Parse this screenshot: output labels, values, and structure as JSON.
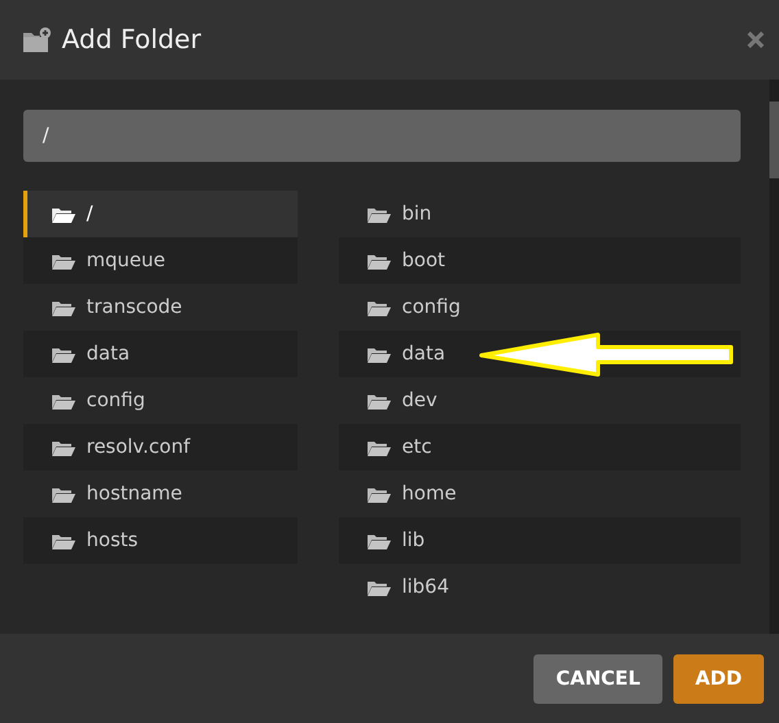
{
  "dialog": {
    "title": "Add Folder"
  },
  "path_field": {
    "value": "/"
  },
  "left_list": [
    {
      "label": "/",
      "selected": true
    },
    {
      "label": "mqueue",
      "selected": false
    },
    {
      "label": "transcode",
      "selected": false
    },
    {
      "label": "data",
      "selected": false
    },
    {
      "label": "config",
      "selected": false
    },
    {
      "label": "resolv.conf",
      "selected": false
    },
    {
      "label": "hostname",
      "selected": false
    },
    {
      "label": "hosts",
      "selected": false
    }
  ],
  "right_list": [
    {
      "label": "bin",
      "selected": false
    },
    {
      "label": "boot",
      "selected": false
    },
    {
      "label": "config",
      "selected": false
    },
    {
      "label": "data",
      "selected": false
    },
    {
      "label": "dev",
      "selected": false
    },
    {
      "label": "etc",
      "selected": false
    },
    {
      "label": "home",
      "selected": false
    },
    {
      "label": "lib",
      "selected": false
    },
    {
      "label": "lib64",
      "selected": false
    }
  ],
  "buttons": [
    {
      "label": "CANCEL",
      "kind": "secondary"
    },
    {
      "label": "ADD",
      "kind": "primary"
    }
  ]
}
